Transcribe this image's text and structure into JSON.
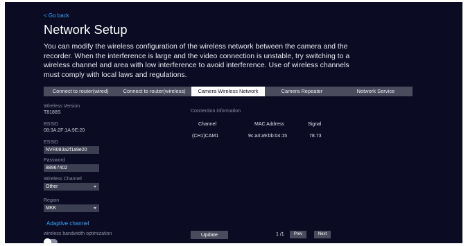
{
  "header": {
    "back_label": "< Go back",
    "title": "Network Setup",
    "description": "You can modify the wireless configuration of the wireless network between the camera and the recorder. When the interference is large and the video connection is unstable, try switching to a wireless channel and area with low interference to avoid interference. Use of wireless channels must comply with local laws and regulations."
  },
  "tabs": [
    {
      "label": "Connect to router(wired)",
      "active": false
    },
    {
      "label": "Connect to router(wireless)",
      "active": false
    },
    {
      "label": "Camera Wireless Network",
      "active": true
    },
    {
      "label": "Camera Repeater",
      "active": false
    },
    {
      "label": "Network Service",
      "active": false
    }
  ],
  "left_panel": {
    "wireless_version_label": "Wireless Version",
    "wireless_version_value": "T8188S",
    "bssid_label": "BSSID",
    "bssid_value": "08:3A:2F:1A:9E:20",
    "essid_label": "ESSID",
    "essid_value": "NVR083a2f1a9e20",
    "password_label": "Password",
    "password_value": "88967402",
    "channel_label": "Wireless Channel",
    "channel_value": "Other",
    "region_label": "Region",
    "region_value": "MKK",
    "adaptive_label": "Adaptive channel",
    "bandwidth_label": "wireless bandwidth optimization",
    "bandwidth_enabled": false
  },
  "connection": {
    "title": "Connection information",
    "headers": {
      "channel": "Channel",
      "mac": "MAC Address",
      "signal": "Signal"
    },
    "rows": [
      {
        "channel": "(CH1)CAM1",
        "mac": "9c:a3:a9:bb:04:15",
        "signal": "78.73"
      }
    ]
  },
  "footer": {
    "update_label": "Update",
    "page_indicator": "1 /1",
    "prev_label": "Prev",
    "next_label": "Next"
  },
  "colors": {
    "background": "#0b0c24",
    "accent": "#3aa5ff",
    "tab_bar": "#4a4c5e",
    "input_bg": "#3c3e52"
  }
}
